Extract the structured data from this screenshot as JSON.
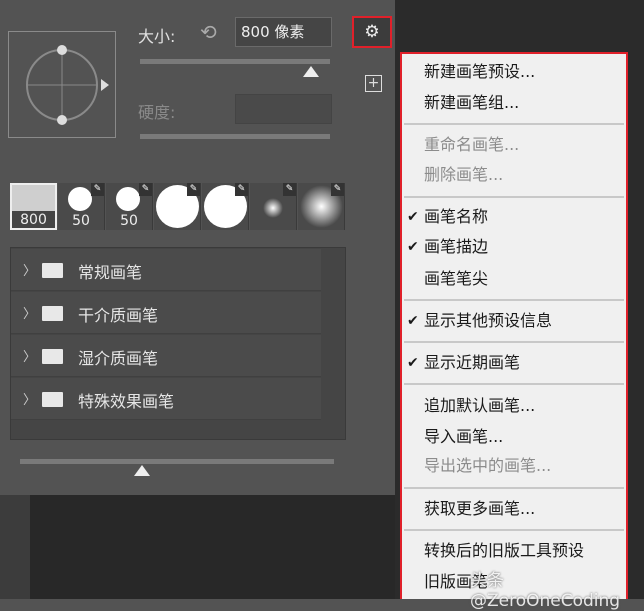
{
  "size": {
    "label": "大小:",
    "value": "800 像素"
  },
  "hardness": {
    "label": "硬度:"
  },
  "size_slider_percent": 0.85,
  "bottom_slider_percent": 0.39,
  "brush_thumbs": [
    {
      "size": "800"
    },
    {
      "size": "50"
    },
    {
      "size": "50"
    },
    {
      "size": ""
    },
    {
      "size": ""
    },
    {
      "size": ""
    },
    {
      "size": ""
    }
  ],
  "brush_groups": [
    "常规画笔",
    "干介质画笔",
    "湿介质画笔",
    "特殊效果画笔"
  ],
  "menu": {
    "items": [
      {
        "label": "新建画笔预设...",
        "checked": false,
        "disabled": false
      },
      {
        "label": "新建画笔组...",
        "checked": false,
        "disabled": false
      },
      {
        "label": "重命名画笔...",
        "checked": false,
        "disabled": true
      },
      {
        "label": "删除画笔...",
        "checked": false,
        "disabled": true
      },
      {
        "label": "画笔名称",
        "checked": true,
        "disabled": false
      },
      {
        "label": "画笔描边",
        "checked": true,
        "disabled": false
      },
      {
        "label": "画笔笔尖",
        "checked": false,
        "disabled": false
      },
      {
        "label": "显示其他预设信息",
        "checked": true,
        "disabled": false
      },
      {
        "label": "显示近期画笔",
        "checked": true,
        "disabled": false
      },
      {
        "label": "追加默认画笔...",
        "checked": false,
        "disabled": false
      },
      {
        "label": "导入画笔...",
        "checked": false,
        "disabled": false
      },
      {
        "label": "导出选中的画笔...",
        "checked": false,
        "disabled": true
      },
      {
        "label": "获取更多画笔...",
        "checked": false,
        "disabled": false
      },
      {
        "label": "转换后的旧版工具预设",
        "checked": false,
        "disabled": false
      },
      {
        "label": "旧版画笔",
        "checked": false,
        "disabled": false
      }
    ]
  },
  "watermark": "头条 @ZeroOneCoding"
}
